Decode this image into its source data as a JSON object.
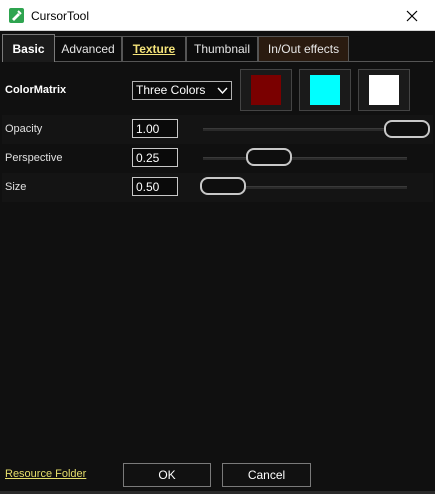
{
  "window": {
    "title": "CursorTool",
    "close_icon": "close-icon",
    "app_icon": "cursortool-app-icon"
  },
  "tabs": [
    {
      "label": "Basic",
      "active": true
    },
    {
      "label": "Advanced"
    },
    {
      "label": "Texture",
      "highlight": true
    },
    {
      "label": "Thumbnail"
    },
    {
      "label": "In/Out effects"
    }
  ],
  "color_matrix": {
    "label": "ColorMatrix",
    "selected": "Three Colors",
    "colors": [
      "#7a0000",
      "#00ffff",
      "#ffffff"
    ]
  },
  "opacity": {
    "label": "Opacity",
    "value": "1.00",
    "slider": 1.0
  },
  "perspective": {
    "label": "Perspective",
    "value": "0.25",
    "slider": 0.25
  },
  "size": {
    "label": "Size",
    "value": "0.50",
    "slider": 0.0
  },
  "footer": {
    "resource_folder": "Resource Folder",
    "ok": "OK",
    "cancel": "Cancel"
  },
  "colors": {
    "background": "#101010",
    "link": "#e7df6b",
    "effects_tab": "#2a1b10"
  }
}
